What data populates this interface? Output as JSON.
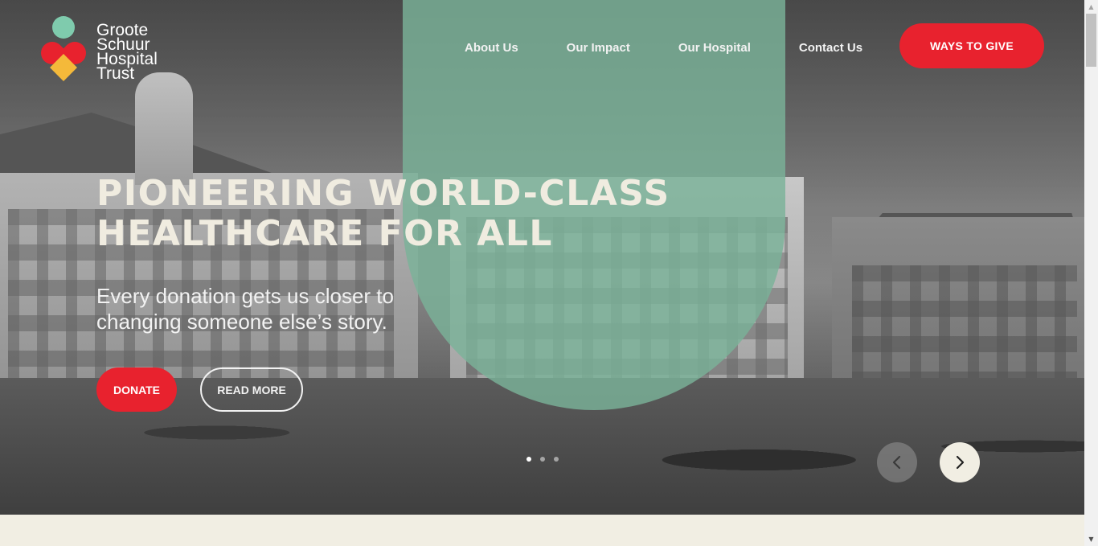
{
  "logo": {
    "lines": [
      "Groote",
      "Schuur",
      "Hospital",
      "Trust"
    ]
  },
  "nav": {
    "items": [
      "About Us",
      "Our Impact",
      "Our Hospital",
      "Contact Us"
    ],
    "cta": "WAYS TO GIVE"
  },
  "hero": {
    "headline_lines": [
      "PIONEERING WORLD-CLASS",
      "HEALTHCARE FOR ALL"
    ],
    "subline_lines": [
      "Every donation gets us closer to",
      "changing someone else’s story."
    ],
    "donate_label": "DONATE",
    "readmore_label": "READ MORE"
  },
  "slider": {
    "active_index": 0,
    "slide_count": 3,
    "prev_icon": "chevron-left-icon",
    "next_icon": "chevron-right-icon"
  },
  "colors": {
    "brand_red": "#e8222e",
    "brand_green": "#7fcbad",
    "brand_yellow": "#f4b93a",
    "cream": "#f1eee3"
  }
}
